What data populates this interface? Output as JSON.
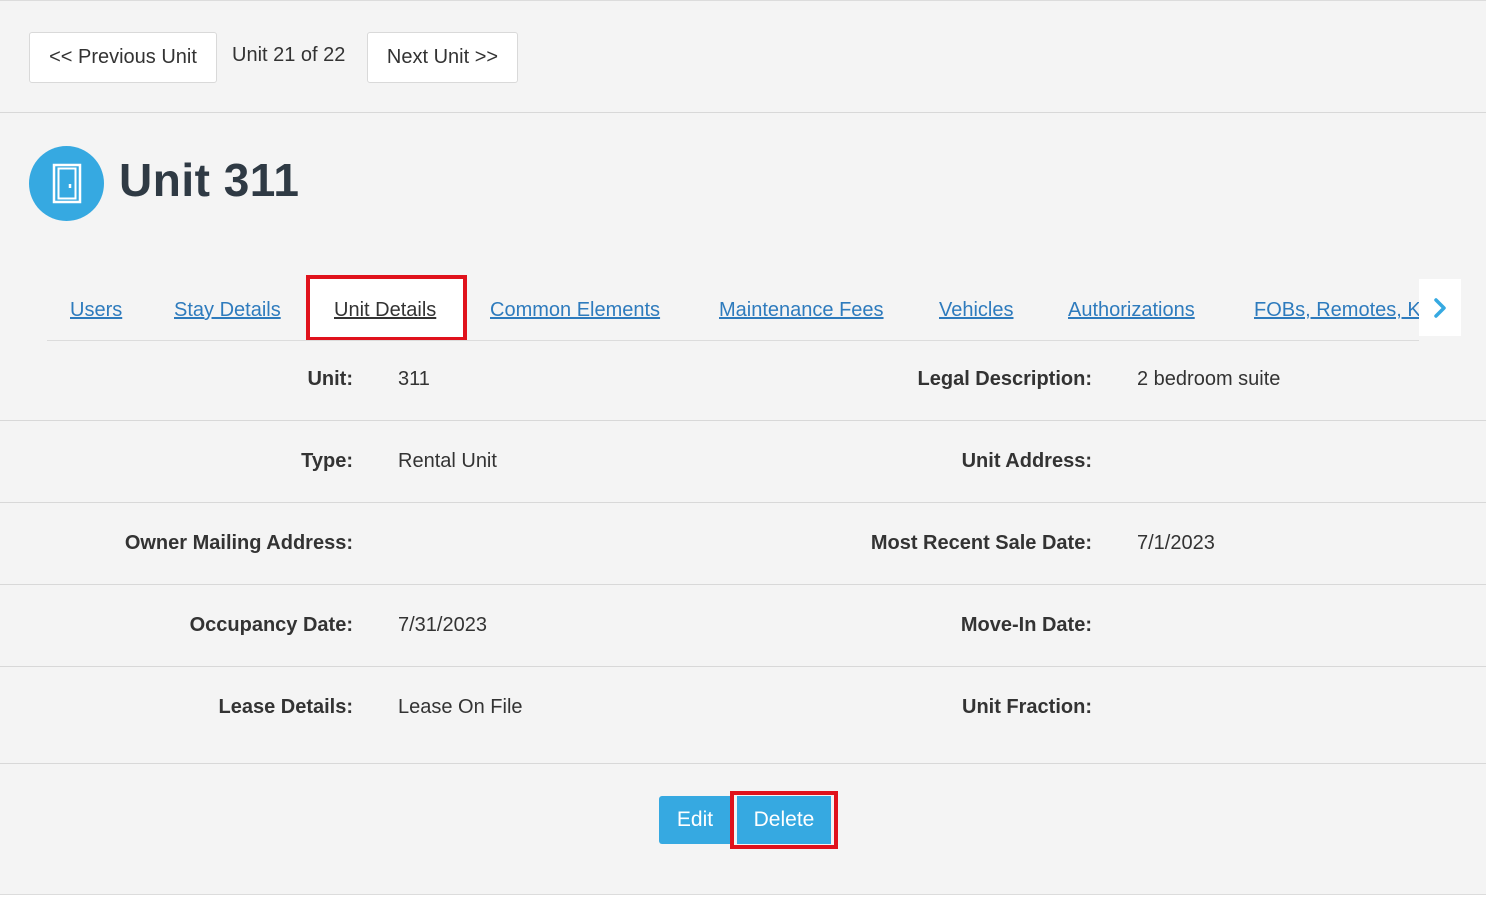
{
  "pager": {
    "prev_label": "<< Previous Unit",
    "status": "Unit 21 of 22",
    "next_label": "Next Unit >>"
  },
  "header": {
    "title": "Unit 311",
    "icon": "door-icon",
    "icon_color": "#36a9e1"
  },
  "tabs": [
    {
      "label": "Users"
    },
    {
      "label": "Stay Details"
    },
    {
      "label": "Unit Details",
      "active": true
    },
    {
      "label": "Common Elements"
    },
    {
      "label": "Maintenance Fees"
    },
    {
      "label": "Vehicles"
    },
    {
      "label": "Authorizations"
    },
    {
      "label": "FOBs, Remotes, K"
    }
  ],
  "details": {
    "rows": [
      {
        "left_label": "Unit:",
        "left_value": "311",
        "right_label": "Legal Description:",
        "right_value": "2 bedroom suite"
      },
      {
        "left_label": "Type:",
        "left_value": "Rental Unit",
        "right_label": "Unit Address:",
        "right_value": ""
      },
      {
        "left_label": "Owner Mailing Address:",
        "left_value": "",
        "right_label": "Most Recent Sale Date:",
        "right_value": "7/1/2023"
      },
      {
        "left_label": "Occupancy Date:",
        "left_value": "7/31/2023",
        "right_label": "Move-In Date:",
        "right_value": ""
      },
      {
        "left_label": "Lease Details:",
        "left_value": "Lease On File",
        "right_label": "Unit Fraction:",
        "right_value": ""
      }
    ]
  },
  "actions": {
    "edit_label": "Edit",
    "delete_label": "Delete"
  },
  "colors": {
    "accent": "#36a9e1",
    "link": "#2e7bbd",
    "highlight": "#e0121c"
  }
}
